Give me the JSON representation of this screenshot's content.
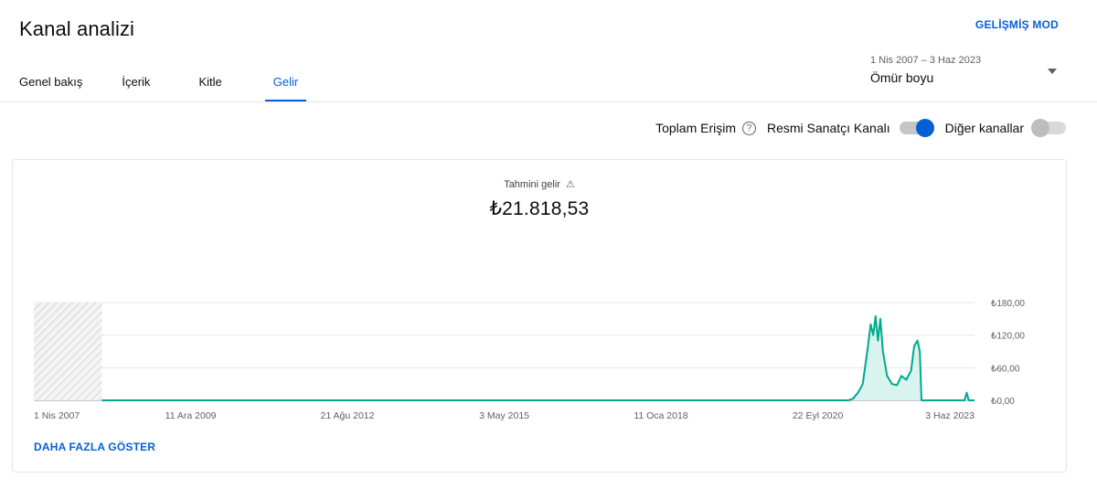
{
  "header": {
    "title": "Kanal analizi",
    "advanced_mode": "GELİŞMİŞ MOD"
  },
  "tabs": [
    {
      "label": "Genel bakış",
      "active": false
    },
    {
      "label": "İçerik",
      "active": false
    },
    {
      "label": "Kitle",
      "active": false
    },
    {
      "label": "Gelir",
      "active": true
    }
  ],
  "date_selector": {
    "range": "1 Nis 2007 – 3 Haz 2023",
    "label": "Ömür boyu"
  },
  "filters": {
    "total_reach": "Toplam Erişim",
    "help_symbol": "?",
    "official_artist": "Resmi Sanatçı Kanalı",
    "official_artist_on": true,
    "other_channels": "Diğer kanallar",
    "other_channels_on": false
  },
  "metric": {
    "label": "Tahmini gelir",
    "value": "₺21.818,53"
  },
  "show_more": "DAHA FAZLA GÖSTER",
  "colors": {
    "accent": "#065fd4",
    "line": "#00a98f",
    "fill": "#d9f3ee"
  },
  "chart_data": {
    "type": "area",
    "y_ticks": [
      {
        "value": 0,
        "label": "₺0,00"
      },
      {
        "value": 60,
        "label": "₺60,00"
      },
      {
        "value": 120,
        "label": "₺120,00"
      },
      {
        "value": 180,
        "label": "₺180,00"
      }
    ],
    "ylim": [
      0,
      180
    ],
    "x_ticks": [
      {
        "date": "2007-04-01",
        "label": "1 Nis 2007"
      },
      {
        "date": "2009-12-11",
        "label": "11 Ara 2009"
      },
      {
        "date": "2012-08-21",
        "label": "21 Ağu 2012"
      },
      {
        "date": "2015-05-03",
        "label": "3 May 2015"
      },
      {
        "date": "2018-01-11",
        "label": "11 Oca 2018"
      },
      {
        "date": "2020-09-22",
        "label": "22 Eyl 2020"
      },
      {
        "date": "2023-06-03",
        "label": "3 Haz 2023"
      }
    ],
    "xlim": [
      "2007-04-01",
      "2023-06-03"
    ],
    "no_data_until": "2008-06-01",
    "series": [
      {
        "points": [
          [
            "2008-06-01",
            0
          ],
          [
            "2021-04-01",
            0
          ],
          [
            "2021-05-01",
            3
          ],
          [
            "2021-06-01",
            14
          ],
          [
            "2021-07-01",
            30
          ],
          [
            "2021-08-01",
            95
          ],
          [
            "2021-08-20",
            140
          ],
          [
            "2021-09-05",
            120
          ],
          [
            "2021-09-20",
            155
          ],
          [
            "2021-10-05",
            110
          ],
          [
            "2021-10-20",
            150
          ],
          [
            "2021-11-05",
            90
          ],
          [
            "2021-12-01",
            45
          ],
          [
            "2022-01-01",
            30
          ],
          [
            "2022-02-01",
            28
          ],
          [
            "2022-03-01",
            45
          ],
          [
            "2022-04-01",
            38
          ],
          [
            "2022-05-01",
            55
          ],
          [
            "2022-05-20",
            100
          ],
          [
            "2022-06-10",
            110
          ],
          [
            "2022-06-25",
            90
          ],
          [
            "2022-07-05",
            0
          ],
          [
            "2023-04-01",
            0
          ],
          [
            "2023-04-15",
            14
          ],
          [
            "2023-04-28",
            0
          ],
          [
            "2023-06-03",
            0
          ]
        ]
      }
    ]
  }
}
